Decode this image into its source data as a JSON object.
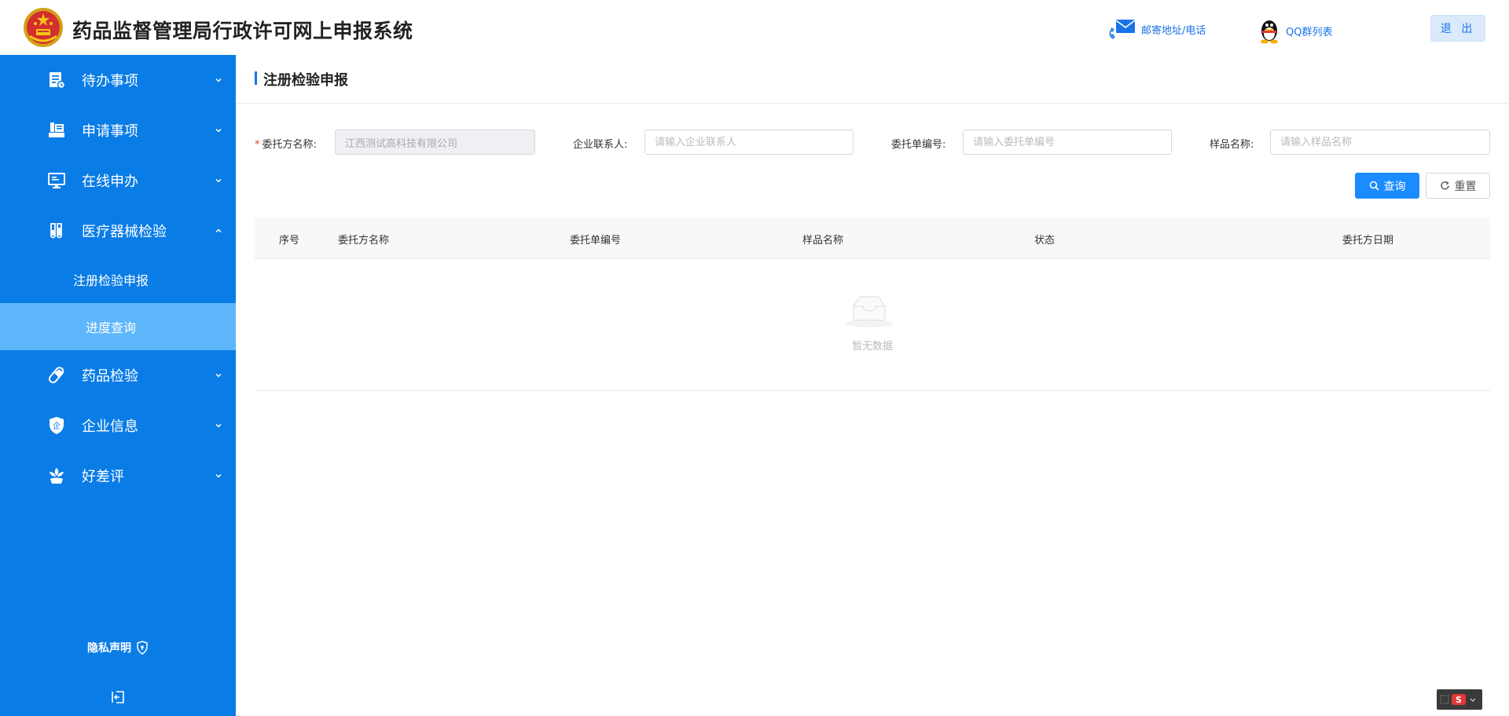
{
  "header": {
    "title": "药品监督管理局行政许可网上申报系统",
    "mail_link": "邮寄地址/电话",
    "qq_link": "QQ群列表",
    "logout": "退 出"
  },
  "sidebar": {
    "items": [
      {
        "label": "待办事项",
        "icon": "todo-list-icon",
        "expanded": false
      },
      {
        "label": "申请事项",
        "icon": "application-icon",
        "expanded": false
      },
      {
        "label": "在线申办",
        "icon": "monitor-icon",
        "expanded": false
      },
      {
        "label": "医疗器械检验",
        "icon": "test-tube-icon",
        "expanded": true,
        "children": [
          {
            "label": "注册检验申报",
            "active": false
          },
          {
            "label": "进度查询",
            "active": true
          }
        ]
      },
      {
        "label": "药品检验",
        "icon": "capsule-icon",
        "expanded": false
      },
      {
        "label": "企业信息",
        "icon": "enterprise-shield-icon",
        "expanded": false
      },
      {
        "label": "好差评",
        "icon": "rating-flower-icon",
        "expanded": false
      }
    ],
    "privacy": "隐私声明"
  },
  "page": {
    "title": "注册检验申报"
  },
  "filters": {
    "client_label": "委托方名称:",
    "client_value": "江西测试高科技有限公司",
    "contact_label": "企业联系人:",
    "contact_placeholder": "请输入企业联系人",
    "order_label": "委托单编号:",
    "order_placeholder": "请输入委托单编号",
    "sample_label": "样品名称:",
    "sample_placeholder": "请输入样品名称",
    "search_button": "查询",
    "reset_button": "重置"
  },
  "table": {
    "columns": [
      "序号",
      "委托方名称",
      "委托单编号",
      "样品名称",
      "状态",
      "委托方日期"
    ],
    "rows": [],
    "empty_text": "暂无数据"
  },
  "colors": {
    "sidebar_bg": "#0a7ce6",
    "active_sub_bg": "#5eb6fb",
    "primary": "#1a8cff"
  }
}
